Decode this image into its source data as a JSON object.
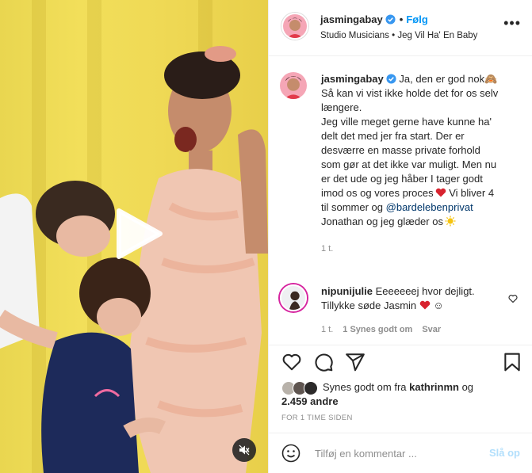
{
  "post": {
    "username": "jasmingabay",
    "follow_label": "Følg",
    "subtitle": "Studio Musicians • Jeg Vil Ha' En Baby"
  },
  "caption": {
    "username": "jasmingabay",
    "line1": " Ja, den er god nok",
    "line1_emoji": "🙈",
    "text_a": "Så kan vi vist ikke holde det for os selv længere.",
    "text_b": "Jeg ville meget gerne have kunne ha' delt det med jer fra start. Der er desværre en masse private forhold som gør at det ikke var muligt. Men nu er det ude og jeg håber I tager godt imod os og vores proces",
    "text_c": " Vi bliver 4 til sommer og ",
    "mention": "@bardelebenprivat",
    "text_d": " Jonathan og jeg glæder os",
    "time": "1 t."
  },
  "comment": {
    "username": "nipunijulie",
    "text_a": " Eeeeeeej hvor dejligt. Tillykke søde Jasmin ",
    "emoji": "☺",
    "time": "1 t.",
    "likes": "1 Synes godt om",
    "reply": "Svar"
  },
  "likes": {
    "prefix": "Synes godt om fra ",
    "user": "kathrinmn",
    "mid": " og",
    "count": "2.459 andre"
  },
  "posted": "FOR 1 TIME SIDEN",
  "add_comment": {
    "placeholder": "Tilføj en kommentar ...",
    "post_label": "Slå op"
  },
  "colors": {
    "accent": "#0095f6",
    "heart": "#ed4956",
    "muted": "#8e8e8e"
  },
  "icons": [
    "play-icon",
    "mute-icon",
    "verified-icon",
    "heart-icon",
    "comment-icon",
    "share-icon",
    "bookmark-icon",
    "emoji-icon",
    "more-icon"
  ]
}
